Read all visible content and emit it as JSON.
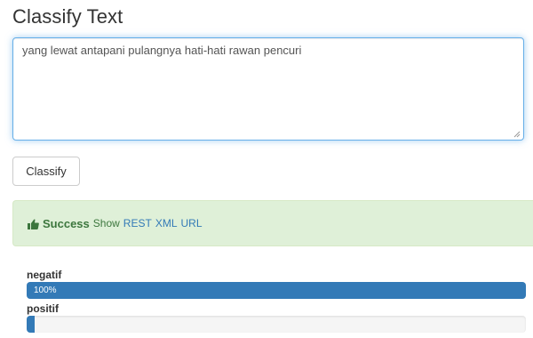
{
  "heading": "Classify Text",
  "input": {
    "value": "yang lewat antapani pulangnya hati-hati rawan pencuri"
  },
  "classify_button": "Classify",
  "alert": {
    "status": "Success",
    "show_text": "Show",
    "links": [
      "REST",
      "XML",
      "URL"
    ],
    "color": "#3c763d",
    "background": "#dff0d8"
  },
  "results": [
    {
      "label": "negatif",
      "percent_text": "100%",
      "fraction": 1.0
    },
    {
      "label": "positif",
      "percent_text": "0%",
      "fraction": 0.0
    }
  ],
  "accent_color": "#337ab7"
}
